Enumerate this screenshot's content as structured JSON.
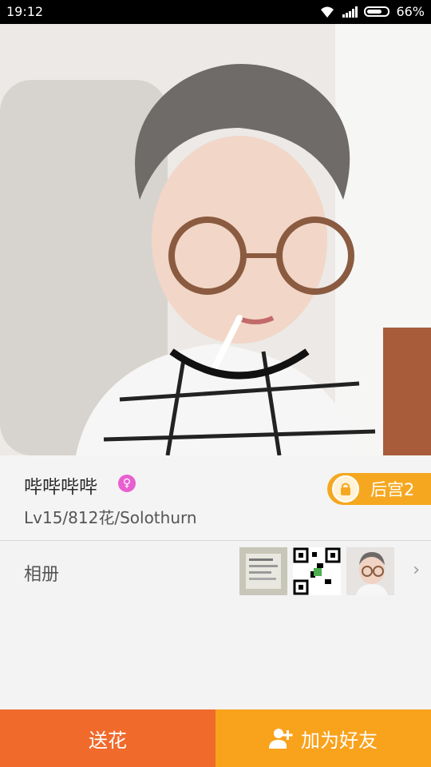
{
  "status": {
    "time": "19:12",
    "battery": "66%"
  },
  "profile": {
    "name": "哔哔哔哔",
    "level": "Lv15/812花/Solothurn",
    "harem_label": "后宫2"
  },
  "album": {
    "title": "相册"
  },
  "actions": {
    "send_flower": "送花",
    "add_friend": "加为好友"
  }
}
